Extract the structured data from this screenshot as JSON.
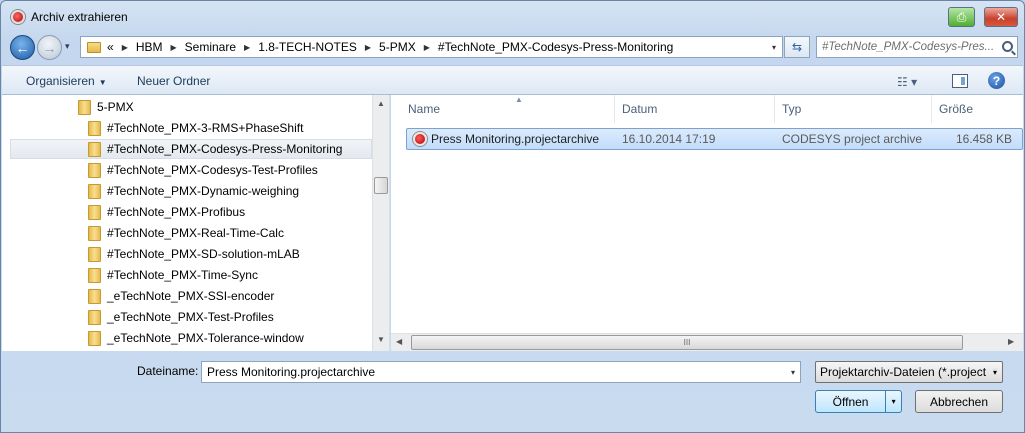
{
  "window": {
    "title": "Archiv extrahieren",
    "restore_glyph": "⎙",
    "close_glyph": "✕"
  },
  "nav": {
    "back_glyph": "←",
    "forward_glyph": "→",
    "history_glyph": "▾"
  },
  "address": {
    "overflow": "«",
    "crumbs": [
      "HBM",
      "Seminare",
      "1.8-TECH-NOTES",
      "5-PMX",
      "#TechNote_PMX-Codesys-Press-Monitoring"
    ],
    "sep_glyph": "▶",
    "dropdown_glyph": "▾",
    "refresh_glyph": "⇆"
  },
  "search": {
    "placeholder": "#TechNote_PMX-Codesys-Pres..."
  },
  "toolbar": {
    "organize_label": "Organisieren",
    "organize_dd": "▼",
    "new_folder_label": "Neuer Ordner",
    "view_glyph": "☷ ▾",
    "help_glyph": "?"
  },
  "tree": {
    "items": [
      {
        "label": "5-PMX"
      },
      {
        "label": "#TechNote_PMX-3-RMS+PhaseShift"
      },
      {
        "label": "#TechNote_PMX-Codesys-Press-Monitoring"
      },
      {
        "label": "#TechNote_PMX-Codesys-Test-Profiles"
      },
      {
        "label": "#TechNote_PMX-Dynamic-weighing"
      },
      {
        "label": "#TechNote_PMX-Profibus"
      },
      {
        "label": "#TechNote_PMX-Real-Time-Calc"
      },
      {
        "label": "#TechNote_PMX-SD-solution-mLAB"
      },
      {
        "label": "#TechNote_PMX-Time-Sync"
      },
      {
        "label": "_eTechNote_PMX-SSI-encoder"
      },
      {
        "label": "_eTechNote_PMX-Test-Profiles"
      },
      {
        "label": "_eTechNote_PMX-Tolerance-window"
      }
    ],
    "selected_index": 2,
    "scroll_up_glyph": "▲",
    "scroll_down_glyph": "▼"
  },
  "files": {
    "columns": [
      "Name",
      "Datum",
      "Typ",
      "Größe"
    ],
    "sort_glyph": "▲",
    "rows": [
      {
        "name": "Press Monitoring.projectarchive",
        "date": "16.10.2014 17:19",
        "type": "CODESYS project archive",
        "size": "16.458 KB"
      }
    ],
    "hscroll_left": "◀",
    "hscroll_right": "▶",
    "hscroll_grip": "III"
  },
  "bottom": {
    "filename_label": "Dateiname:",
    "filename_value": "Press Monitoring.projectarchive",
    "filename_dd": "▾",
    "filter_value": "Projektarchiv-Dateien (*.project",
    "filter_dd": "▾",
    "open_label": "Öffnen",
    "open_dd": "▾",
    "cancel_label": "Abbrechen"
  }
}
